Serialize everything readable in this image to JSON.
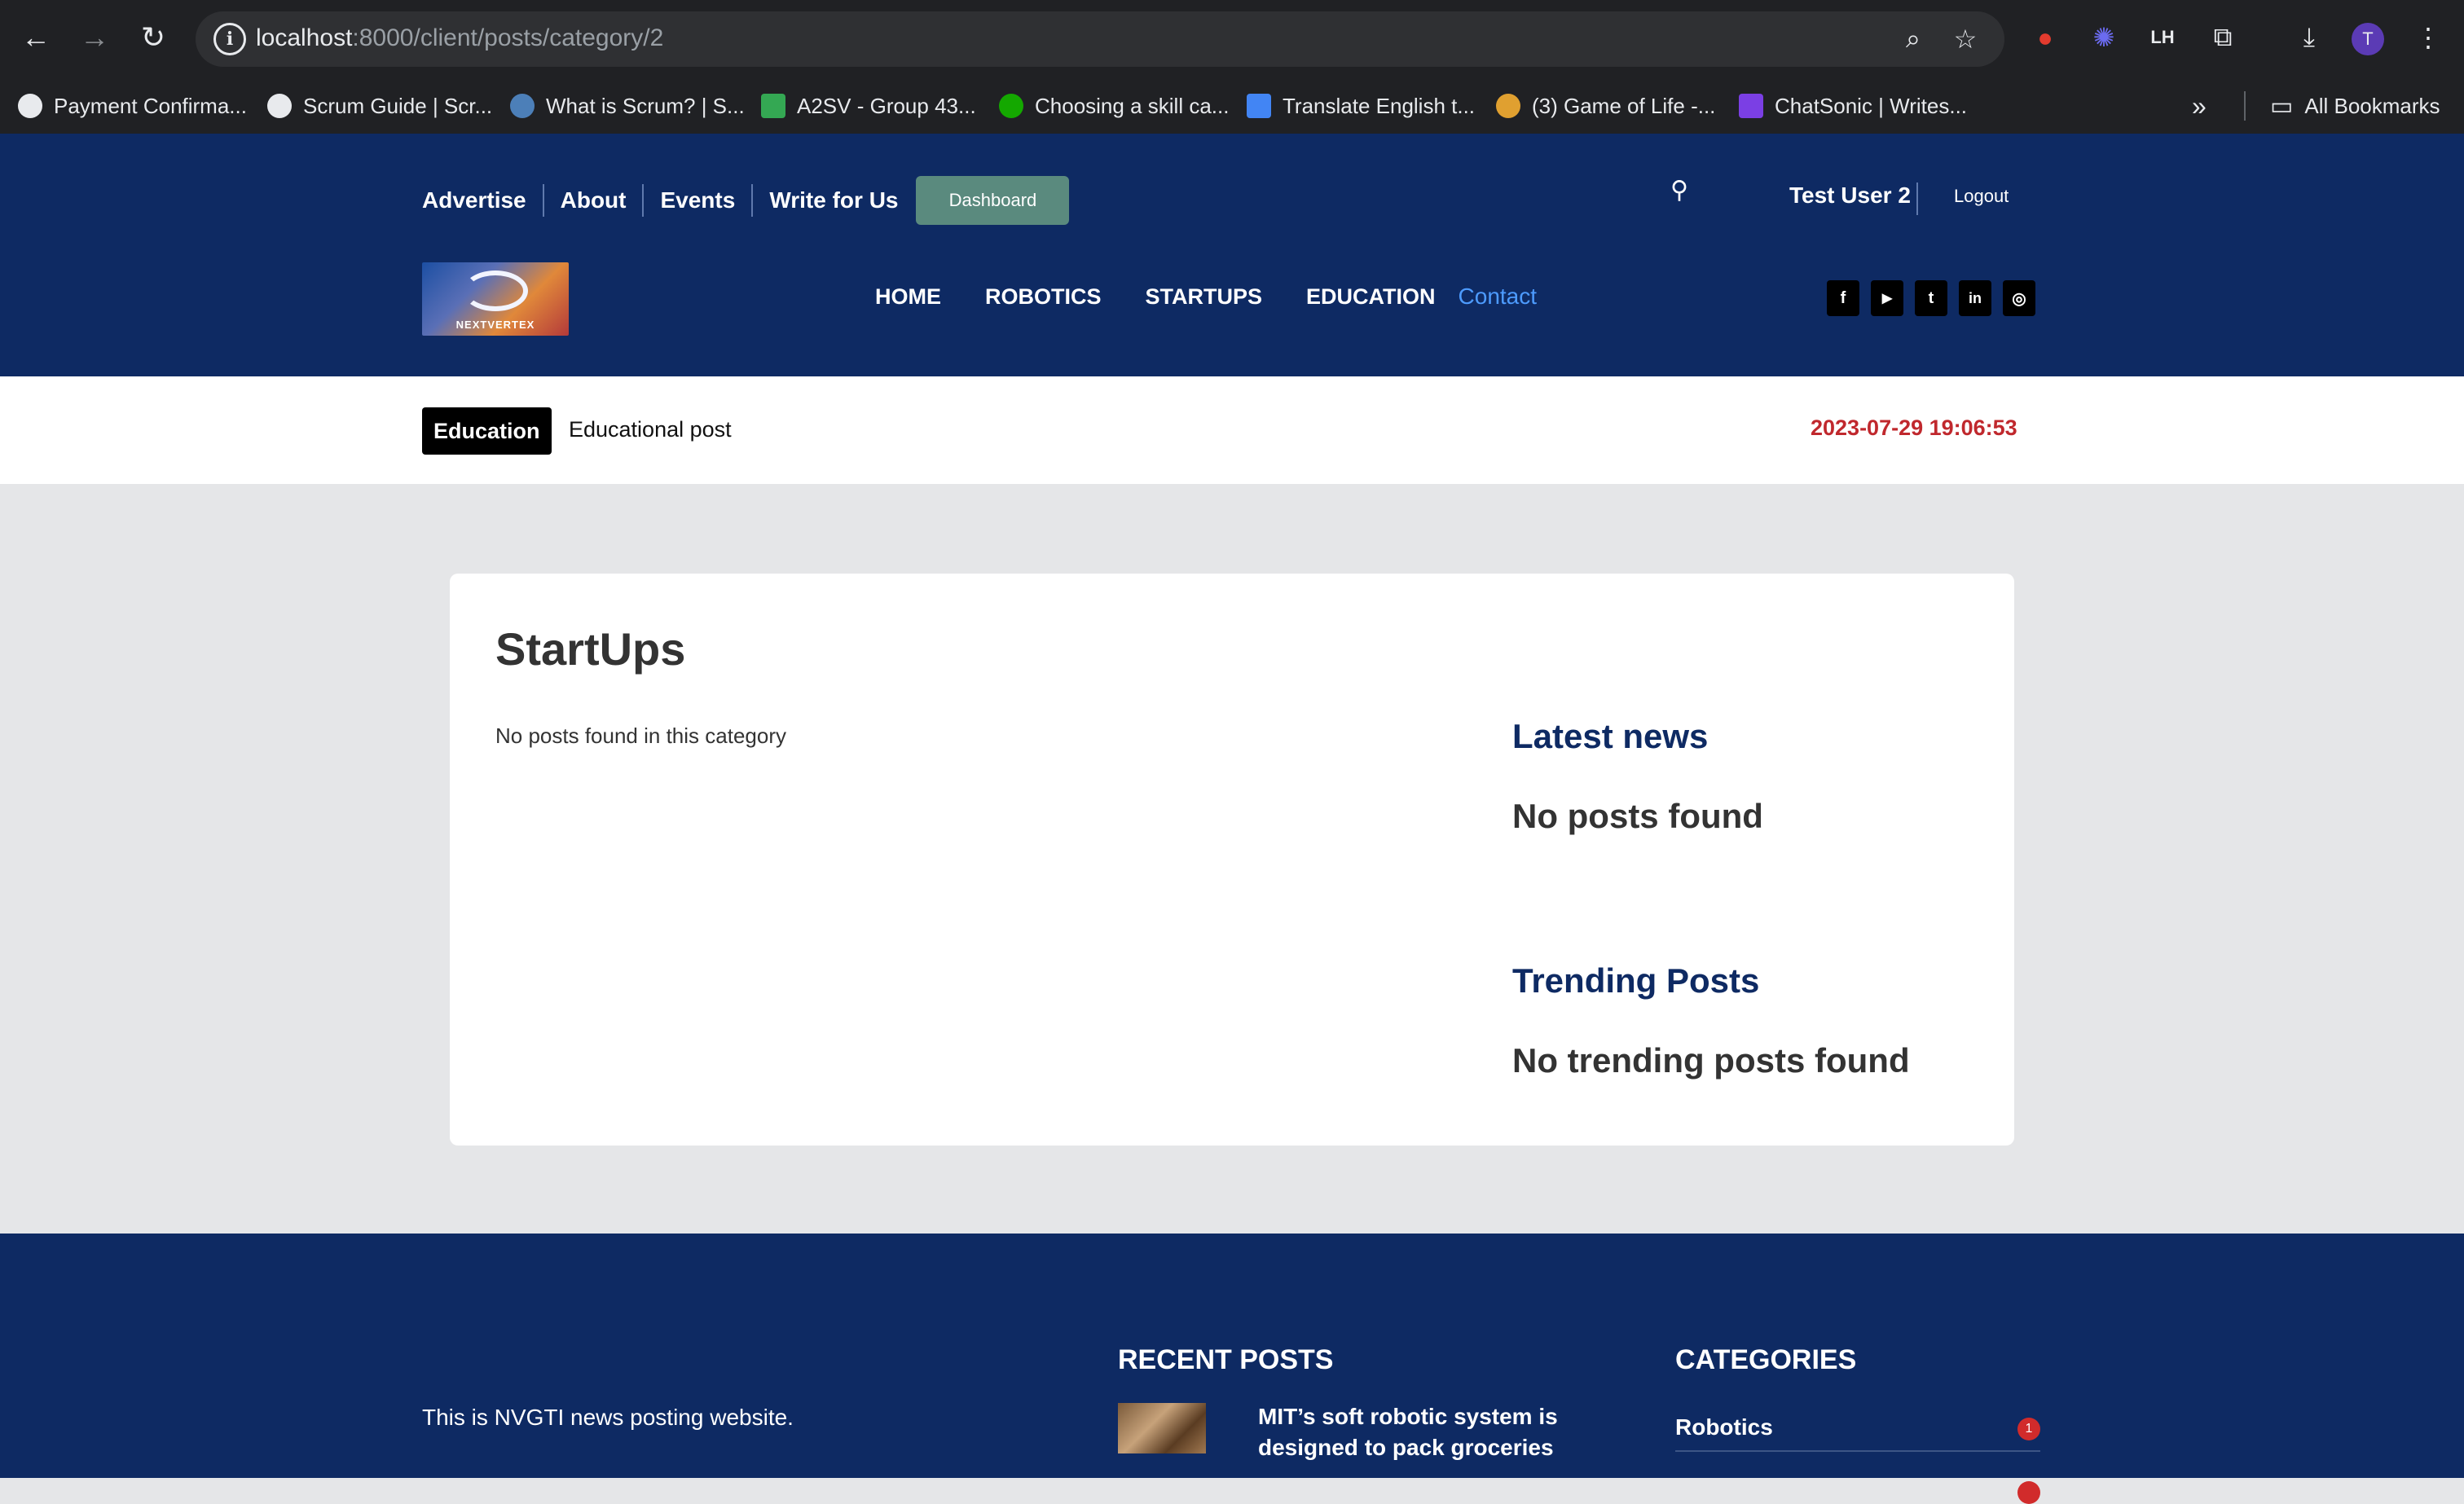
{
  "browser": {
    "url_host": "localhost",
    "url_path": ":8000/client/posts/category/2",
    "bookmarks": [
      {
        "label": "Payment Confirma...",
        "color": "#e8eaed"
      },
      {
        "label": "Scrum Guide | Scr...",
        "color": "#e8eaed"
      },
      {
        "label": "What is Scrum? | S...",
        "color": "#4c7fb8"
      },
      {
        "label": "A2SV - Group 43...",
        "color": "#34a853"
      },
      {
        "label": "Choosing a skill ca...",
        "color": "#14a800"
      },
      {
        "label": "Translate English t...",
        "color": "#4285f4"
      },
      {
        "label": "(3) Game of Life -...",
        "color": "#e0a030"
      },
      {
        "label": "ChatSonic | Writes...",
        "color": "#7b3fe4"
      }
    ],
    "all_bookmarks": "All Bookmarks",
    "profile_initial": "T"
  },
  "header": {
    "top_links": [
      "Advertise",
      "About",
      "Events",
      "Write for Us"
    ],
    "dashboard": "Dashboard",
    "user": "Test User 2",
    "logout": "Logout",
    "logo_text": "NEXTVERTEX",
    "main_nav": [
      "HOME",
      "ROBOTICS",
      "STARTUPS",
      "EDUCATION"
    ],
    "contact": "Contact",
    "socials": [
      "f",
      "▶",
      "t",
      "in",
      "◎"
    ]
  },
  "ticker": {
    "badge": "Education",
    "text": "Educational post",
    "date": "2023-07-29 19:06:53"
  },
  "main": {
    "title": "StartUps",
    "empty_message": "No posts found in this category",
    "latest_heading": "Latest news",
    "latest_empty": "No posts found",
    "trending_heading": "Trending Posts",
    "trending_empty": "No trending posts found"
  },
  "footer": {
    "description": "This is NVGTI news posting website.",
    "recent_heading": "RECENT POSTS",
    "recent_post_title": "MIT’s soft robotic system is designed to pack groceries",
    "categories_heading": "CATEGORIES",
    "categories": [
      {
        "name": "Robotics",
        "count": "1"
      }
    ]
  }
}
